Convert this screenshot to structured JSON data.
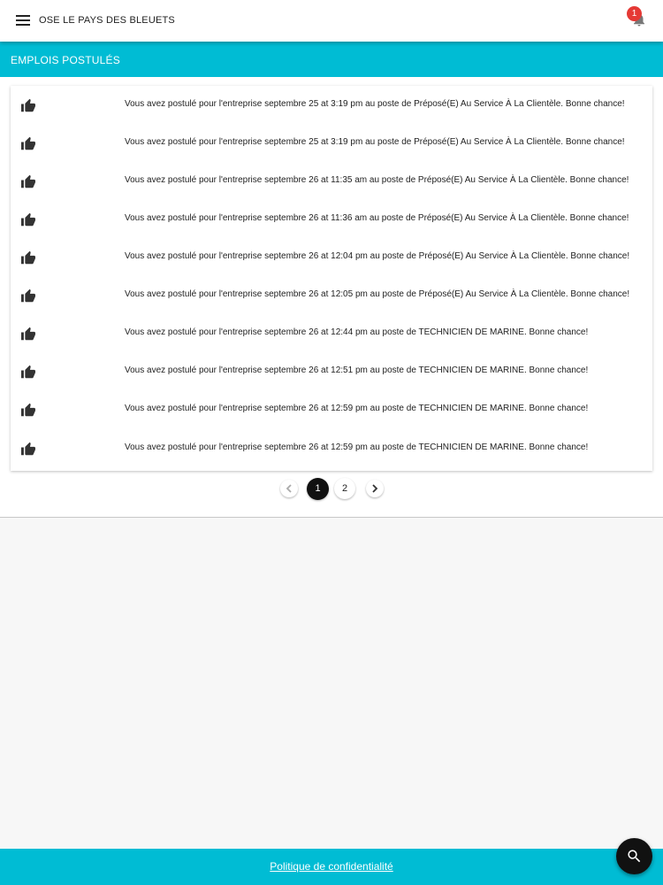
{
  "header": {
    "app_title": "OSE LE PAYS DES BLEUETS",
    "notification_count": "1",
    "menu_icon": "menu-icon",
    "bell_icon": "bell-icon"
  },
  "section": {
    "title": "EMPLOIS POSTULÉS"
  },
  "applications": [
    {
      "icon": "thumb-up-icon",
      "text": "Vous avez postulé pour l'entreprise septembre 25 at 3:19 pm au poste de Préposé(E) Au Service À La Clientèle. Bonne chance!"
    },
    {
      "icon": "thumb-up-icon",
      "text": "Vous avez postulé pour l'entreprise septembre 25 at 3:19 pm au poste de Préposé(E) Au Service À La Clientèle. Bonne chance!"
    },
    {
      "icon": "thumb-up-icon",
      "text": "Vous avez postulé pour l'entreprise septembre 26 at 11:35 am au poste de Préposé(E) Au Service À La Clientèle. Bonne chance!"
    },
    {
      "icon": "thumb-up-icon",
      "text": "Vous avez postulé pour l'entreprise septembre 26 at 11:36 am au poste de Préposé(E) Au Service À La Clientèle. Bonne chance!"
    },
    {
      "icon": "thumb-up-icon",
      "text": "Vous avez postulé pour l'entreprise septembre 26 at 12:04 pm au poste de Préposé(E) Au Service À La Clientèle. Bonne chance!"
    },
    {
      "icon": "thumb-up-icon",
      "text": "Vous avez postulé pour l'entreprise septembre 26 at 12:05 pm au poste de Préposé(E) Au Service À La Clientèle. Bonne chance!"
    },
    {
      "icon": "thumb-up-icon",
      "text": "Vous avez postulé pour l'entreprise septembre 26 at 12:44 pm au poste de TECHNICIEN DE MARINE. Bonne chance!"
    },
    {
      "icon": "thumb-up-icon",
      "text": "Vous avez postulé pour l'entreprise septembre 26 at 12:51 pm au poste de TECHNICIEN DE MARINE. Bonne chance!"
    },
    {
      "icon": "thumb-up-icon",
      "text": "Vous avez postulé pour l'entreprise septembre 26 at 12:59 pm au poste de TECHNICIEN DE MARINE. Bonne chance!"
    },
    {
      "icon": "thumb-up-icon",
      "text": "Vous avez postulé pour l'entreprise septembre 26 at 12:59 pm au poste de TECHNICIEN DE MARINE. Bonne chance!"
    }
  ],
  "pagination": {
    "pages": [
      "1",
      "2"
    ],
    "current": "1",
    "prev_icon": "chevron-left-icon",
    "next_icon": "chevron-right-icon"
  },
  "footer": {
    "privacy_link": "Politique de confidentialité"
  },
  "fab": {
    "icon": "search-icon"
  },
  "colors": {
    "accent": "#00bcd4",
    "badge": "#e53935",
    "fab": "#111111"
  }
}
